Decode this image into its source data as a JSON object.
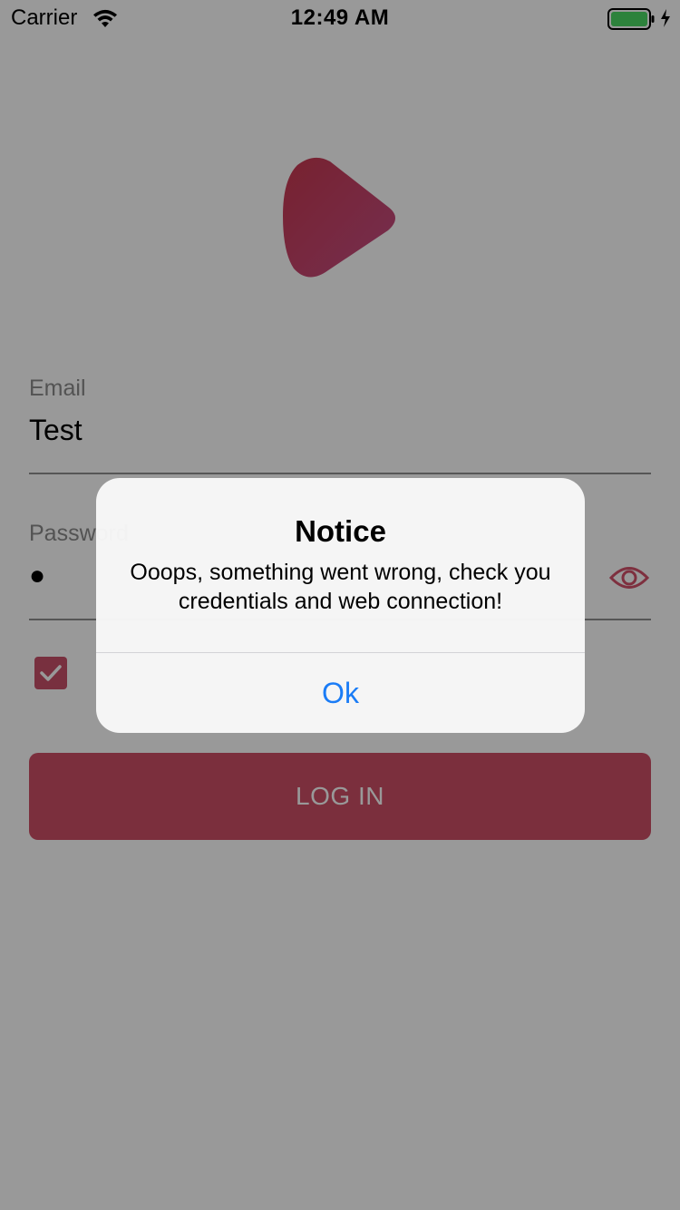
{
  "status_bar": {
    "carrier": "Carrier",
    "time": "12:49 AM",
    "battery_color": "#4cd964"
  },
  "logo": {
    "icon": "play-icon",
    "gradient_start": "#c8384f",
    "gradient_end": "#c44f86"
  },
  "form": {
    "email_label": "Email",
    "email_value": "Test",
    "password_label": "Password",
    "password_value": "●",
    "remember_checked": true,
    "login_label": "LOG IN",
    "accent": "#ce4f67"
  },
  "alert": {
    "title": "Notice",
    "message": "Ooops, something went wrong, check you credentials and web connection!",
    "ok_label": "Ok",
    "ok_color": "#1a7cf6"
  }
}
